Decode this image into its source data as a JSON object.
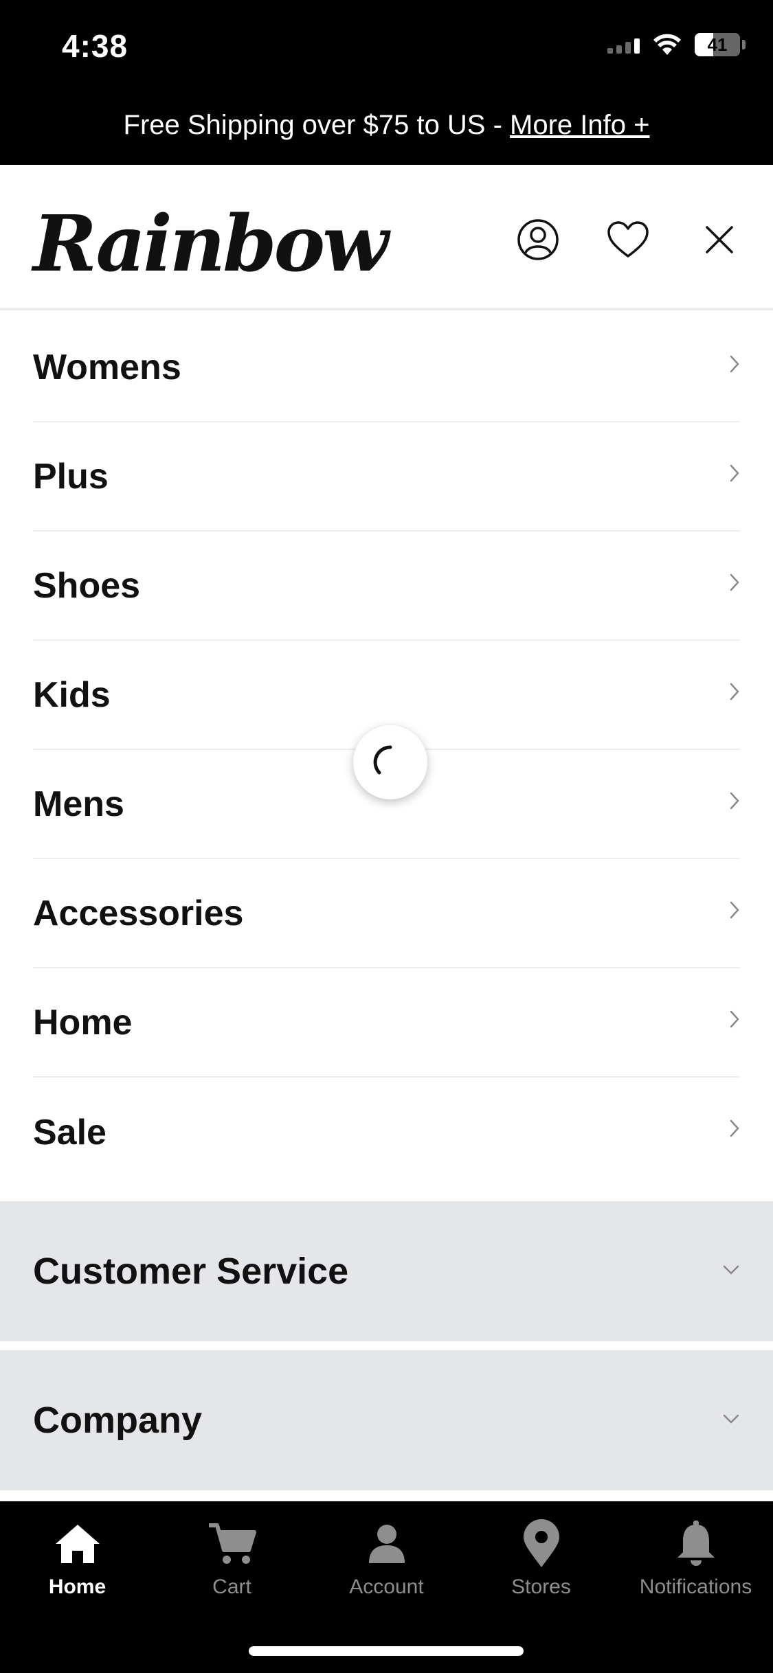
{
  "status_bar": {
    "time": "4:38",
    "battery": "41",
    "battery_level": 0.41
  },
  "promo": {
    "text": "Free Shipping over $75 to US - ",
    "link": "More Info +"
  },
  "header": {
    "logo": "Rainbow"
  },
  "menu": {
    "items": [
      {
        "label": "Womens"
      },
      {
        "label": "Plus"
      },
      {
        "label": "Shoes"
      },
      {
        "label": "Kids"
      },
      {
        "label": "Mens"
      },
      {
        "label": "Accessories"
      },
      {
        "label": "Home"
      },
      {
        "label": "Sale"
      }
    ]
  },
  "accordions": [
    {
      "label": "Customer Service"
    },
    {
      "label": "Company"
    }
  ],
  "tabbar": {
    "tabs": [
      {
        "label": "Home",
        "icon": "home-icon",
        "active": true
      },
      {
        "label": "Cart",
        "icon": "cart-icon",
        "active": false
      },
      {
        "label": "Account",
        "icon": "account-icon",
        "active": false
      },
      {
        "label": "Stores",
        "icon": "location-pin-icon",
        "active": false
      },
      {
        "label": "Notifications",
        "icon": "bell-icon",
        "active": false
      }
    ]
  },
  "colors": {
    "background": "#ffffff",
    "black_bar": "#000000",
    "accordion_bg": "#e5e6ea",
    "inactive_tab": "#8e8e8e"
  }
}
